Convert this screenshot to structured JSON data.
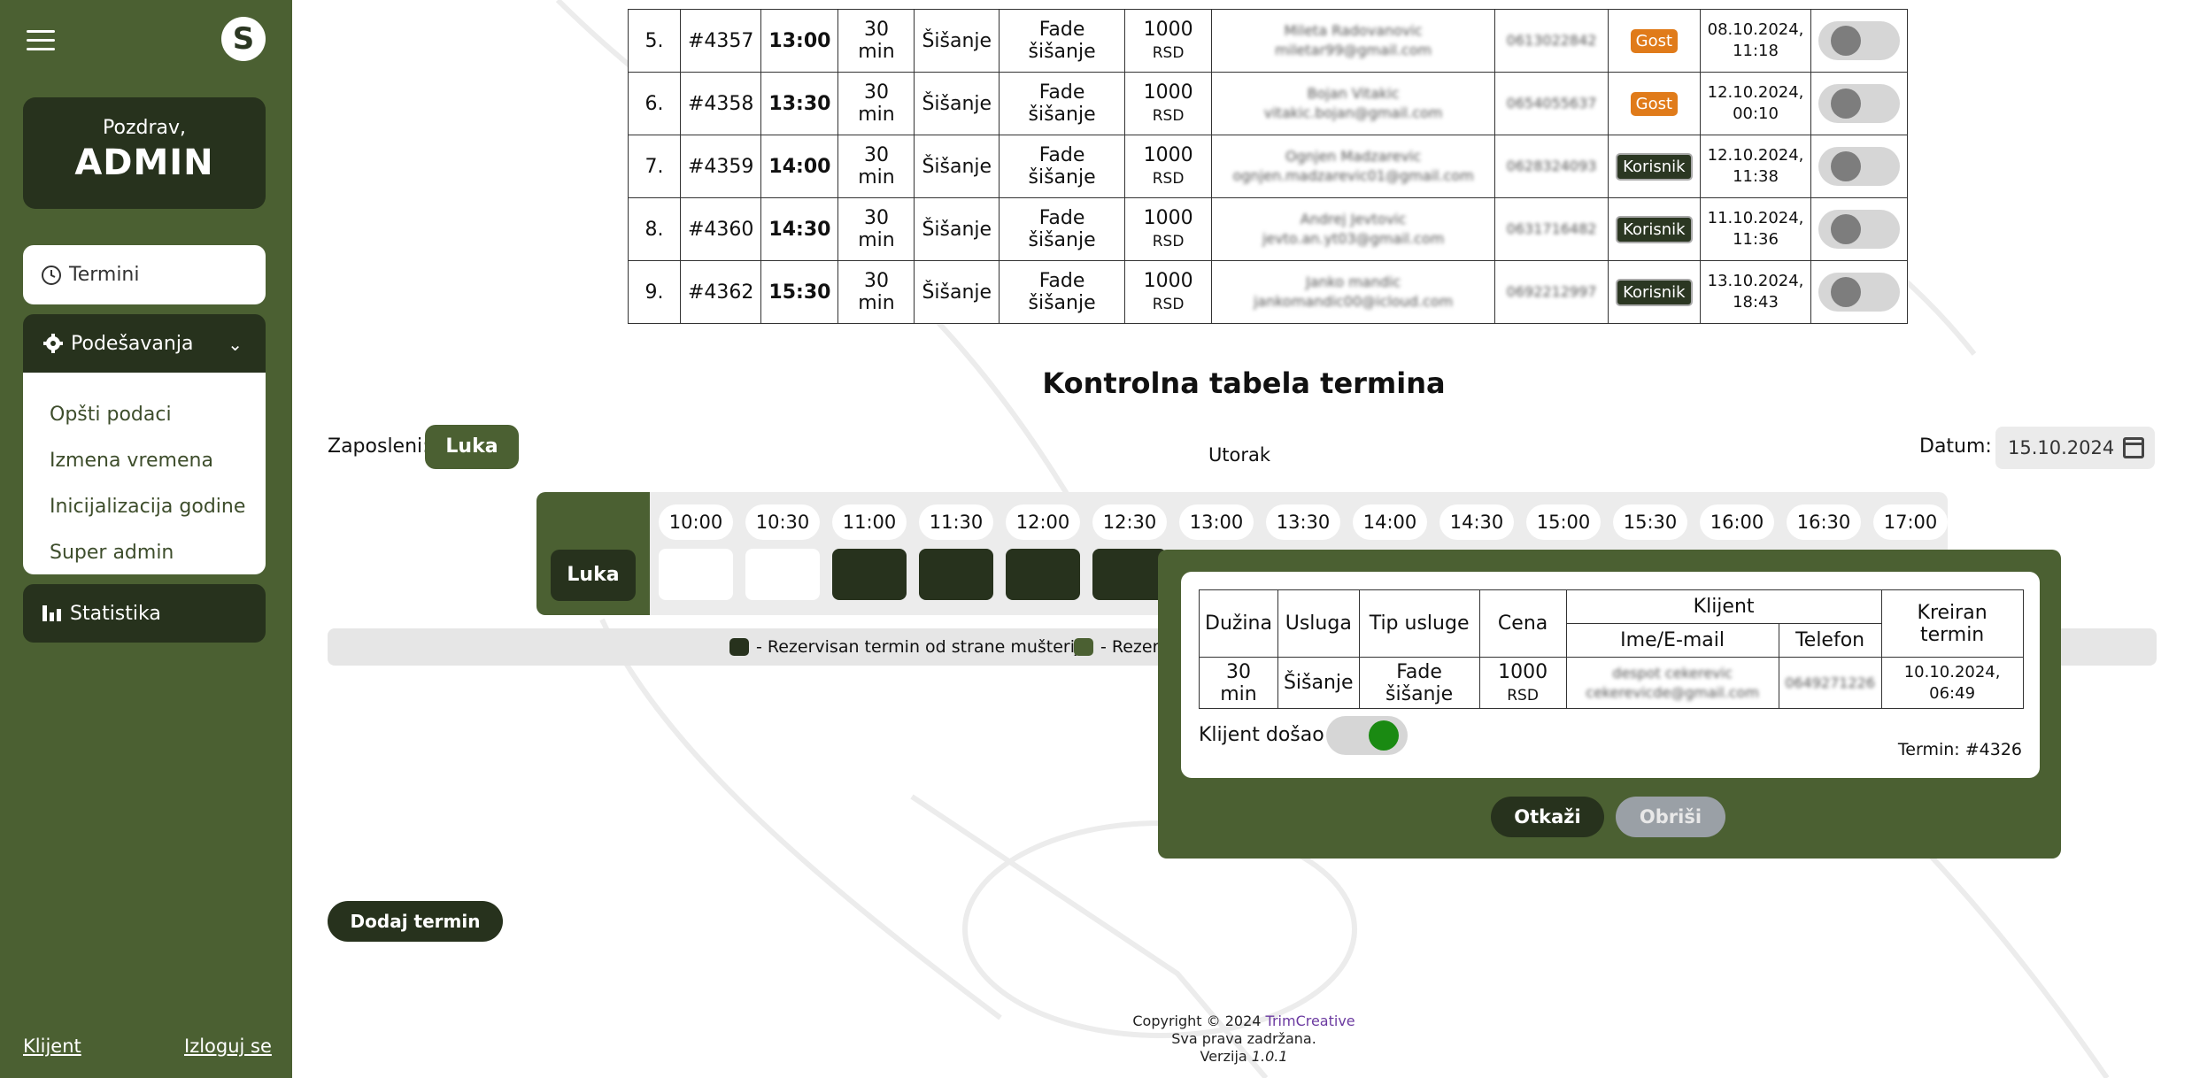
{
  "sidebar": {
    "logo": "S",
    "greeting": "Pozdrav,",
    "user": "ADMIN",
    "nav_termini": "Termini",
    "nav_podesavanja": "Podešavanja",
    "submenu": [
      "Opšti podaci",
      "Izmena vremena",
      "Inicijalizacija godine",
      "Super admin"
    ],
    "nav_statistika": "Statistika",
    "link_klijent": "Klijent",
    "link_logout": "Izloguj se"
  },
  "table_rows": [
    {
      "no": "5.",
      "id": "#4357",
      "time": "13:00",
      "dur": "30 min",
      "usluga": "Šišanje",
      "tip": "Fade šišanje",
      "price": "1000",
      "cur": "RSD",
      "name": "Mileta Radovanovic",
      "email": "miletar99@gmail.com",
      "phone": "0613022842",
      "badge": "Gost",
      "created1": "08.10.2024,",
      "created2": "11:18"
    },
    {
      "no": "6.",
      "id": "#4358",
      "time": "13:30",
      "dur": "30 min",
      "usluga": "Šišanje",
      "tip": "Fade šišanje",
      "price": "1000",
      "cur": "RSD",
      "name": "Bojan Vitakic",
      "email": "vitakic.bojan@gmail.com",
      "phone": "0654055637",
      "badge": "Gost",
      "created1": "12.10.2024,",
      "created2": "00:10"
    },
    {
      "no": "7.",
      "id": "#4359",
      "time": "14:00",
      "dur": "30 min",
      "usluga": "Šišanje",
      "tip": "Fade šišanje",
      "price": "1000",
      "cur": "RSD",
      "name": "Ognjen Madzarevic",
      "email": "ognjen.madzarevic01@gmail.com",
      "phone": "0628324093",
      "badge": "Korisnik",
      "created1": "12.10.2024,",
      "created2": "11:38"
    },
    {
      "no": "8.",
      "id": "#4360",
      "time": "14:30",
      "dur": "30 min",
      "usluga": "Šišanje",
      "tip": "Fade šišanje",
      "price": "1000",
      "cur": "RSD",
      "name": "Andrej Jevtovic",
      "email": "jevto.an.yt03@gmail.com",
      "phone": "0631716482",
      "badge": "Korisnik",
      "created1": "11.10.2024,",
      "created2": "11:36"
    },
    {
      "no": "9.",
      "id": "#4362",
      "time": "15:30",
      "dur": "30 min",
      "usluga": "Šišanje",
      "tip": "Fade šišanje",
      "price": "1000",
      "cur": "RSD",
      "name": "Janko mandic",
      "email": "jankomandic00@icloud.com",
      "phone": "0692212997",
      "badge": "Korisnik",
      "created1": "13.10.2024,",
      "created2": "18:43"
    }
  ],
  "control": {
    "title": "Kontrolna tabela termina",
    "zaposleni_label": "Zaposleni:",
    "zaposleni_value": "Luka",
    "day": "Utorak",
    "datum_label": "Datum:",
    "datum_value": "15.10.2024",
    "employee": "Luka",
    "times": [
      "10:00",
      "10:30",
      "11:00",
      "11:30",
      "12:00",
      "12:30",
      "13:00",
      "13:30",
      "14:00",
      "14:30",
      "15:00",
      "15:30",
      "16:00",
      "16:30",
      "17:00"
    ],
    "visible_slots": [
      "free",
      "free",
      "reserved",
      "reserved",
      "reserved",
      "reserved"
    ],
    "legend1": "- Rezervisan termin od strane mušterije",
    "legend2": "- Rezerv"
  },
  "modal": {
    "h_duzina": "Dužina",
    "h_usluga": "Usluga",
    "h_tip": "Tip usluge",
    "h_cena": "Cena",
    "h_klijent": "Klijent",
    "h_ime": "Ime/E-mail",
    "h_telefon": "Telefon",
    "h_kreiran": "Kreiran termin",
    "duzina": "30 min",
    "usluga": "Šišanje",
    "tip": "Fade šišanje",
    "cena": "1000",
    "cur": "RSD",
    "ime": "despot cekerevic",
    "email": "cekerevicde@gmail.com",
    "telefon": "0649271226",
    "kreiran1": "10.10.2024,",
    "kreiran2": "06:49",
    "klijent_dosao": "Klijent došao",
    "klijent_dosao_on": true,
    "termin_id": "Termin: #4326",
    "btn_otkazi": "Otkaži",
    "btn_obrisi": "Obriši"
  },
  "add_button": "Dodaj termin",
  "footer": {
    "copy": "Copyright © 2024",
    "brand": "TrimCreative",
    "rights": "Sva prava zadržana.",
    "ver_label": "Verzija",
    "ver": "1.0.1"
  },
  "colors": {
    "sidebar": "#4b6032",
    "dark": "#27321d",
    "gost": "#e07b1a",
    "toggle_on": "#1a8a12"
  }
}
